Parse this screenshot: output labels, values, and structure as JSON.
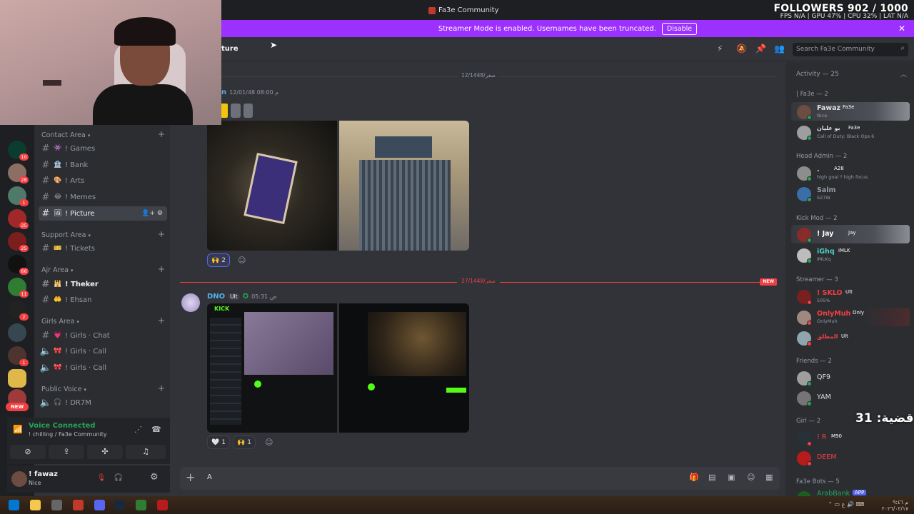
{
  "window": {
    "title": "Fa3e Community"
  },
  "stream_overlay": {
    "followers": "FOLLOWERS 902 / 1000",
    "perf": "FPS N/A | GPU 47% | CPU 32% | LAT N/A",
    "case_counter": "قضية: 31"
  },
  "banner": {
    "text": "Streamer Mode is enabled. Usernames have been truncated.",
    "button": "Disable"
  },
  "server_rail": {
    "badges": [
      "10",
      "28",
      "1",
      "25",
      "25",
      "66",
      "11",
      "2",
      "1"
    ],
    "new_label": "NEW"
  },
  "channels": {
    "categories": [
      {
        "name": "Contact Area"
      },
      {
        "name": "Support Area"
      },
      {
        "name": "Ajr Area"
      },
      {
        "name": "Girls Area"
      },
      {
        "name": "Public Voice"
      }
    ],
    "items": [
      {
        "label": "! Games",
        "emoji": "👾"
      },
      {
        "label": "! Bank",
        "emoji": "🏦"
      },
      {
        "label": "! Arts",
        "emoji": "🎨"
      },
      {
        "label": "! Memes",
        "emoji": "😂"
      },
      {
        "label": "! Picture",
        "emoji": "🖼"
      },
      {
        "label": "! Tickets",
        "emoji": "🎫"
      },
      {
        "label": "! Theker",
        "emoji": "🕌"
      },
      {
        "label": "! Ehsan",
        "emoji": "🤲"
      },
      {
        "label": "! Girls · Chat",
        "emoji": "💗"
      },
      {
        "label": "! Girls · Call",
        "emoji": "🎀"
      },
      {
        "label": "! Girls · Call",
        "emoji": "🎀"
      },
      {
        "label": "! DR7M",
        "emoji": "🎧"
      }
    ]
  },
  "voice": {
    "status": "Voice Connected",
    "channel": "! chilling / Fa3e Community"
  },
  "user": {
    "name": "! fawaz",
    "status": "Nice"
  },
  "header": {
    "channel_name": "ture",
    "search_placeholder": "Search Fa3e Community"
  },
  "messages": {
    "divider1": "12/1448/صفر",
    "msg1_time": "12/01/48 08:00 م",
    "msg1_author": "n",
    "reactions1": [
      {
        "emoji": "🙌",
        "count": "2"
      }
    ],
    "divider2": "27/1448/صفر",
    "new_label": "NEW",
    "msg2_author": "DNO",
    "msg2_tag": "Ult",
    "msg2_time": "05:31 ص",
    "reactions2": [
      {
        "emoji": "🤍",
        "count": "1"
      },
      {
        "emoji": "🙌",
        "count": "1"
      }
    ],
    "kick_label": "KICK"
  },
  "composer": {
    "text": "A"
  },
  "members": {
    "activity": "Activity — 25",
    "groups": [
      {
        "label": "| Fa3e — 2"
      },
      {
        "label": "Head Admin — 2"
      },
      {
        "label": "Kick Mod — 2"
      },
      {
        "label": "Streamer — 3"
      },
      {
        "label": "Friends — 2"
      },
      {
        "label": "Girl — 2"
      },
      {
        "label": "Fa3e Bots — 5"
      }
    ],
    "list": [
      {
        "name": "Fawaz",
        "tag": "Fa3e",
        "sub": "Nice",
        "color": "#dbdee1"
      },
      {
        "name": "بو عليان",
        "tag": "Fa3e",
        "sub": "Call of Duty: Black Ops 6",
        "color": "#dbdee1"
      },
      {
        "name": ".",
        "tag": "A28",
        "sub": "high goal ? high focus",
        "color": "#dbdee1"
      },
      {
        "name": "Salm",
        "tag": "",
        "sub": "S27W",
        "color": "#949ba4"
      },
      {
        "name": "! Jay",
        "tag": "Jay",
        "sub": "",
        "color": "#ffffff"
      },
      {
        "name": "iGhq",
        "tag": "iMLK",
        "sub": "iMLKq",
        "color": "#4fd1c5"
      },
      {
        "name": "! SKLO",
        "tag": "Ult",
        "sub": "505%",
        "color": "#f23f42"
      },
      {
        "name": "OnlyMuh",
        "tag": "Only",
        "sub": "OnlyMuh",
        "color": "#f23f42"
      },
      {
        "name": "المطلق",
        "tag": "Ult",
        "sub": "",
        "color": "#f23f42"
      },
      {
        "name": "QF9",
        "tag": "",
        "sub": "",
        "color": "#dbdee1"
      },
      {
        "name": "YAM",
        "tag": "",
        "sub": "",
        "color": "#dbdee1"
      },
      {
        "name": "! R",
        "tag": "M90",
        "sub": "",
        "color": "#f23f42"
      },
      {
        "name": "DEEM",
        "tag": "",
        "sub": "",
        "color": "#f23f42"
      },
      {
        "name": "ArabBank",
        "tag": "APP",
        "sub": "",
        "color": "#23a55a"
      }
    ]
  },
  "taskbar": {
    "time": "م ٩:٤٦",
    "date": "٢٠٢٦/٠٢/١٧"
  },
  "colors": {
    "accent": "#5865f2",
    "banner": "#9b30ff",
    "online": "#23a55a",
    "danger": "#f23f42"
  }
}
